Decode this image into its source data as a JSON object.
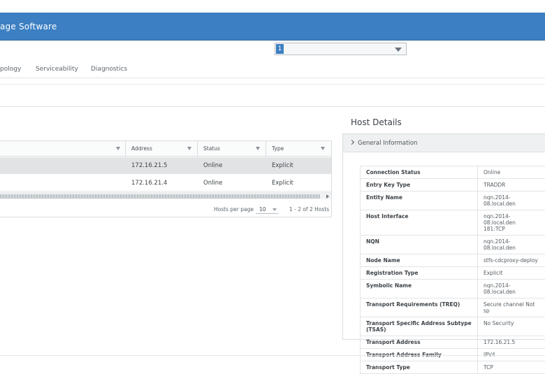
{
  "header": {
    "title": "age Software",
    "color": "#3c7fc2"
  },
  "selector": {
    "selected": "1"
  },
  "tabs": [
    {
      "label": "pology"
    },
    {
      "label": "Serviceability"
    },
    {
      "label": "Diagnostics"
    }
  ],
  "hosts_table": {
    "columns": [
      "Address",
      "Status",
      "Type"
    ],
    "rows": [
      {
        "address": "172.16.21.5",
        "status": "Online",
        "type": "Explicit"
      },
      {
        "address": "172.16.21.4",
        "status": "Online",
        "type": "Explicit"
      }
    ],
    "footer": {
      "per_page_label": "Hosts per page",
      "per_page_value": "10",
      "range": "1 - 2 of 2 Hosts"
    }
  },
  "host_details": {
    "title": "Host Details",
    "section": "General Information",
    "properties": [
      {
        "key": "Connection Status",
        "value": "Online"
      },
      {
        "key": "Entry Key Type",
        "value": "TRADDR"
      },
      {
        "key": "Entity Name",
        "value": "nqn.2014-08.local.den"
      },
      {
        "key": "Host Interface",
        "value": "nqn.2014-08.local.den\n181:TCP"
      },
      {
        "key": "NQN",
        "value": "nqn.2014-08.local.den"
      },
      {
        "key": "Node Name",
        "value": "stfs-cdcproxy-deploy"
      },
      {
        "key": "Registration Type",
        "value": "Explicit"
      },
      {
        "key": "Symbolic Name",
        "value": "nqn.2014-08.local.den"
      },
      {
        "key": "Transport Requirements (TREQ)",
        "value": "Secure channel Not sp"
      },
      {
        "key": "Transport Specific Address Subtype (TSAS)",
        "value": "No Security"
      },
      {
        "key": "Transport Address",
        "value": "172.16.21.5"
      },
      {
        "key": "Transport Address Family",
        "value": "IPV4"
      },
      {
        "key": "Transport Type",
        "value": "TCP"
      }
    ]
  }
}
